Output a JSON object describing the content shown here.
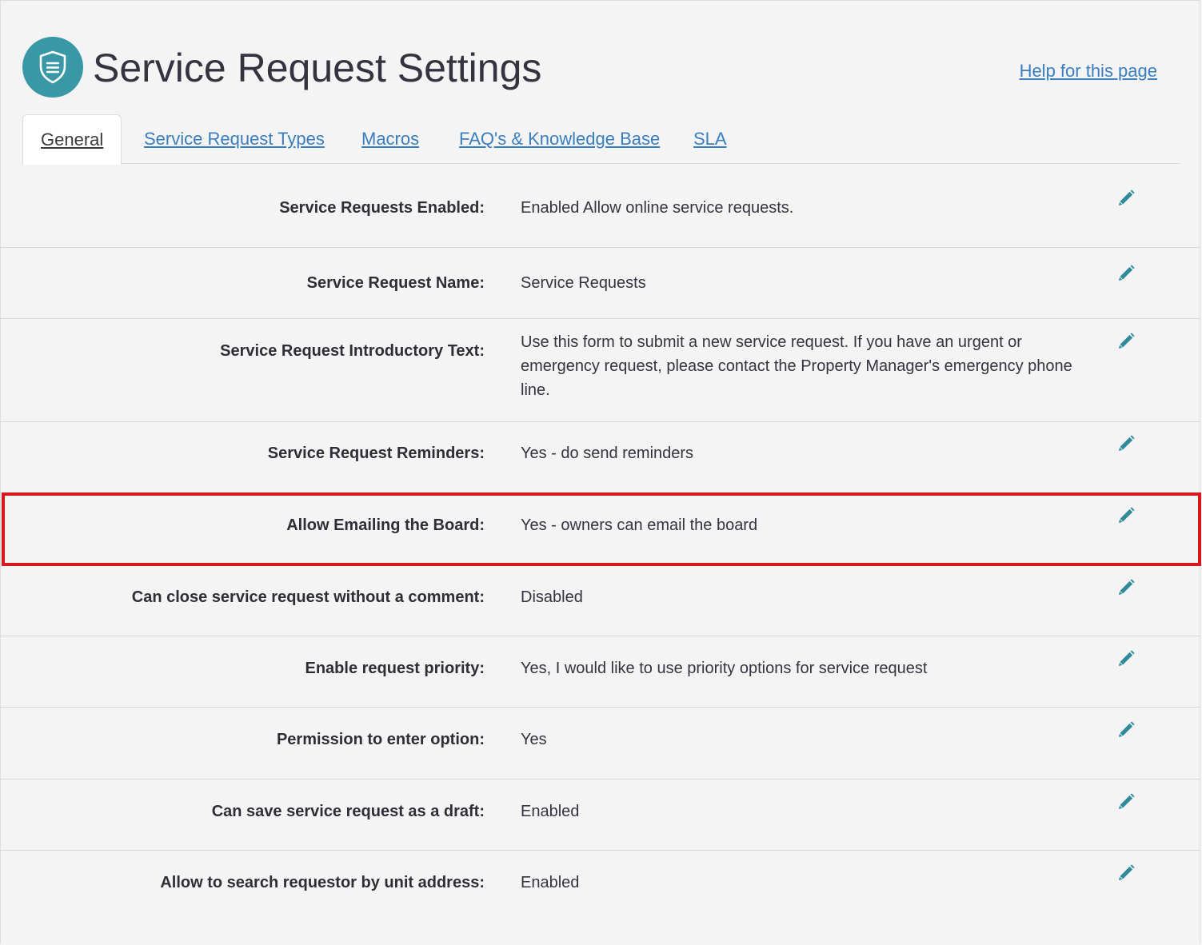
{
  "colors": {
    "accent": "#3a98a6",
    "link": "#3a7ebf",
    "highlight": "#d7191c",
    "edit_icon": "#2f8a9c"
  },
  "header": {
    "icon": "shield-list-icon",
    "title": "Service Request Settings",
    "help_link": "Help for this page"
  },
  "tabs": [
    {
      "label": "General",
      "active": true
    },
    {
      "label": "Service Request Types",
      "active": false
    },
    {
      "label": "Macros",
      "active": false
    },
    {
      "label": "FAQ's & Knowledge Base",
      "active": false
    },
    {
      "label": "SLA",
      "active": false
    }
  ],
  "settings": [
    {
      "label": "Service Requests Enabled:",
      "value": "Enabled Allow online service requests.",
      "edit_icon": "pencil-icon"
    },
    {
      "label": "Service Request Name:",
      "value": "Service Requests",
      "edit_icon": "pencil-icon"
    },
    {
      "label": "Service Request Introductory Text:",
      "value": "Use this form to submit a new service request. If you have an urgent or emergency request, please contact the Property Manager's emergency phone line.",
      "edit_icon": "pencil-icon"
    },
    {
      "label": "Service Request Reminders:",
      "value": "Yes - do send reminders",
      "edit_icon": "pencil-icon"
    },
    {
      "label": "Allow Emailing the Board:",
      "value": "Yes - owners can email the board",
      "edit_icon": "pencil-icon",
      "highlighted": true
    },
    {
      "label": "Can close service request without a comment:",
      "value": "Disabled",
      "edit_icon": "pencil-icon"
    },
    {
      "label": "Enable request priority:",
      "value": "Yes, I would like to use priority options for service request",
      "edit_icon": "pencil-icon"
    },
    {
      "label": "Permission to enter option:",
      "value": "Yes",
      "edit_icon": "pencil-icon"
    },
    {
      "label": "Can save service request as a draft:",
      "value": "Enabled",
      "edit_icon": "pencil-icon"
    },
    {
      "label": "Allow to search requestor by unit address:",
      "value": "Enabled",
      "edit_icon": "pencil-icon"
    }
  ]
}
